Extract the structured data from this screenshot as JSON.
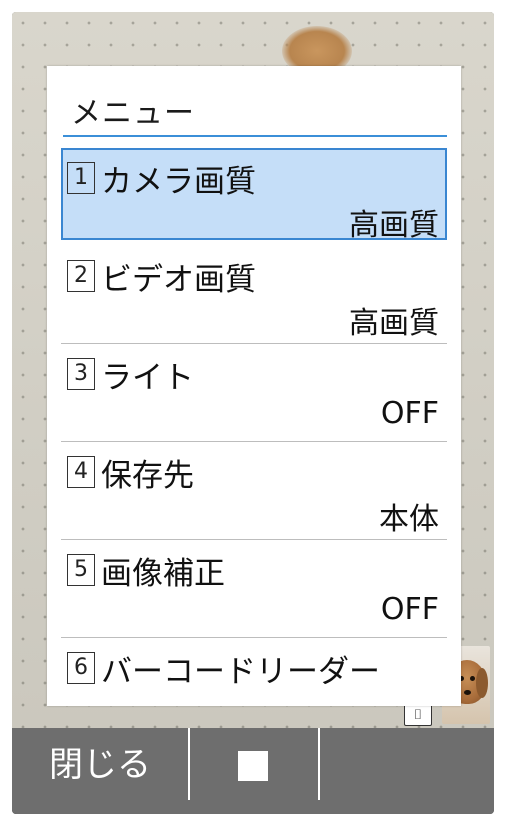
{
  "menu": {
    "title": "メニュー",
    "items": [
      {
        "number": "1",
        "label": "カメラ画質",
        "value": "高画質",
        "selected": true
      },
      {
        "number": "2",
        "label": "ビデオ画質",
        "value": "高画質",
        "selected": false
      },
      {
        "number": "3",
        "label": "ライト",
        "value": "OFF",
        "selected": false
      },
      {
        "number": "4",
        "label": "保存先",
        "value": "本体",
        "selected": false
      },
      {
        "number": "5",
        "label": "画像補正",
        "value": "OFF",
        "selected": false
      },
      {
        "number": "6",
        "label": "バーコードリーダー",
        "value": "",
        "selected": false
      }
    ]
  },
  "softkeys": {
    "left_label": "閉じる",
    "center_icon": "stop-icon",
    "right_label": ""
  },
  "viewfinder": {
    "thumbnail_icon": "camera-icon",
    "thumbnail_content": "dog-photo"
  },
  "colors": {
    "accent": "#3a86d1",
    "selection": "#c5def8",
    "softkey_bar": "#6e6e6e"
  }
}
